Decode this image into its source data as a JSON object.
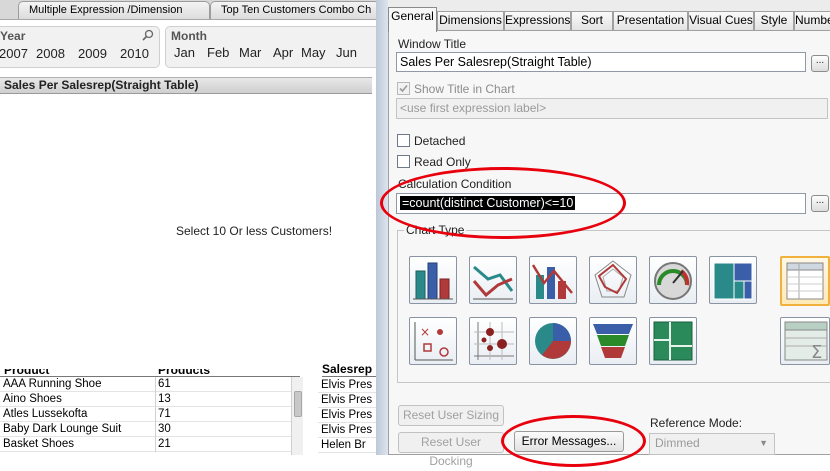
{
  "sheet_tabs": [
    "Multiple Expression /Dimension",
    "Top Ten Customers Combo Ch"
  ],
  "year_listbox": {
    "title": "Year",
    "values": [
      "2007",
      "2008",
      "2009",
      "2010"
    ]
  },
  "month_listbox": {
    "title": "Month",
    "values": [
      "Jan",
      "Feb",
      "Mar",
      "Apr",
      "May",
      "Jun"
    ]
  },
  "chart": {
    "title": "Sales Per Salesrep(Straight Table)",
    "message": "Select 10 Or less Customers!"
  },
  "product_table": {
    "header_product": "Product",
    "header_value": "Products",
    "rows": [
      {
        "name": "AAA Running Shoe",
        "value": "61"
      },
      {
        "name": "Aino Shoes",
        "value": "13"
      },
      {
        "name": "Atles Lussekofta",
        "value": "71"
      },
      {
        "name": "Baby Dark Lounge Suit",
        "value": "30"
      },
      {
        "name": "Basket Shoes",
        "value": "21"
      }
    ]
  },
  "salesrep_table": {
    "header": "Salesrep",
    "rows": [
      "Elvis Pres",
      "Elvis Pres",
      "Elvis Pres",
      "Elvis Pres",
      "Helen Br"
    ]
  },
  "dialog": {
    "tabs": [
      "General",
      "Dimensions",
      "Expressions",
      "Sort",
      "Presentation",
      "Visual Cues",
      "Style",
      "Number"
    ],
    "window_title_label": "Window Title",
    "window_title_value": "Sales Per Salesrep(Straight Table)",
    "show_title_label": "Show Title in Chart",
    "title_placeholder": "<use first expression label>",
    "detached_label": "Detached",
    "read_only_label": "Read Only",
    "calc_condition_label": "Calculation Condition",
    "calc_condition_value": "=count(distinct Customer)<=10",
    "chart_type_label": "Chart Type",
    "dots": "...",
    "reset_sizing": "Reset User Sizing",
    "reset_docking": "Reset User Docking",
    "error_messages": "Error Messages...",
    "reference_mode_label": "Reference Mode:",
    "reference_mode_value": "Dimmed"
  },
  "colors": {
    "annotation": "#e8000d",
    "selected_icon": "#f0b23c"
  }
}
